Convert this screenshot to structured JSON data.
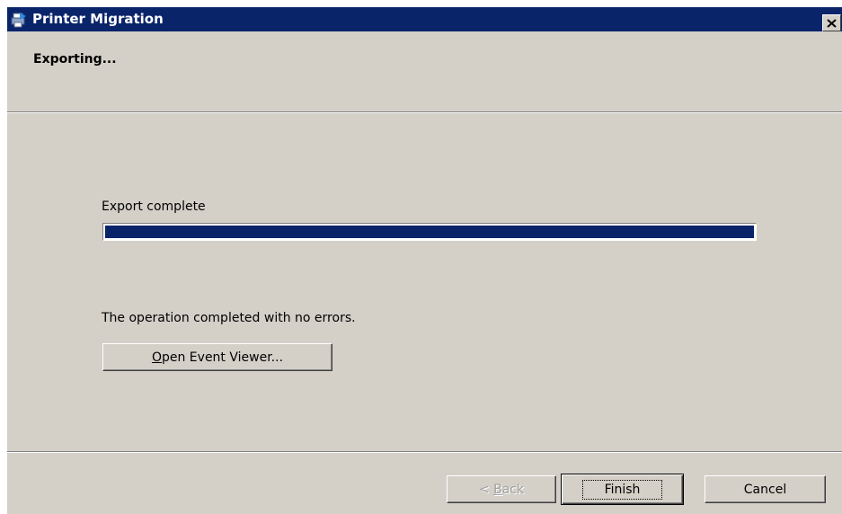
{
  "window": {
    "title": "Printer Migration",
    "close_glyph": "✕",
    "icon": "printer-migration-icon"
  },
  "header": {
    "title": "Exporting..."
  },
  "main": {
    "status_label": "Export complete",
    "progress_percent": 100,
    "result_text": "The operation completed with no errors.",
    "event_viewer_button": {
      "accel": "O",
      "rest": "pen Event Viewer..."
    }
  },
  "footer": {
    "back_button": {
      "prefix": "< ",
      "accel": "B",
      "rest": "ack",
      "enabled": false
    },
    "finish_label": "Finish",
    "cancel_label": "Cancel"
  },
  "colors": {
    "titlebar": "#0a246a",
    "window_bg": "#d4d0c8",
    "progress_fill": "#0a246a",
    "disabled_text": "#a0a0a0"
  }
}
